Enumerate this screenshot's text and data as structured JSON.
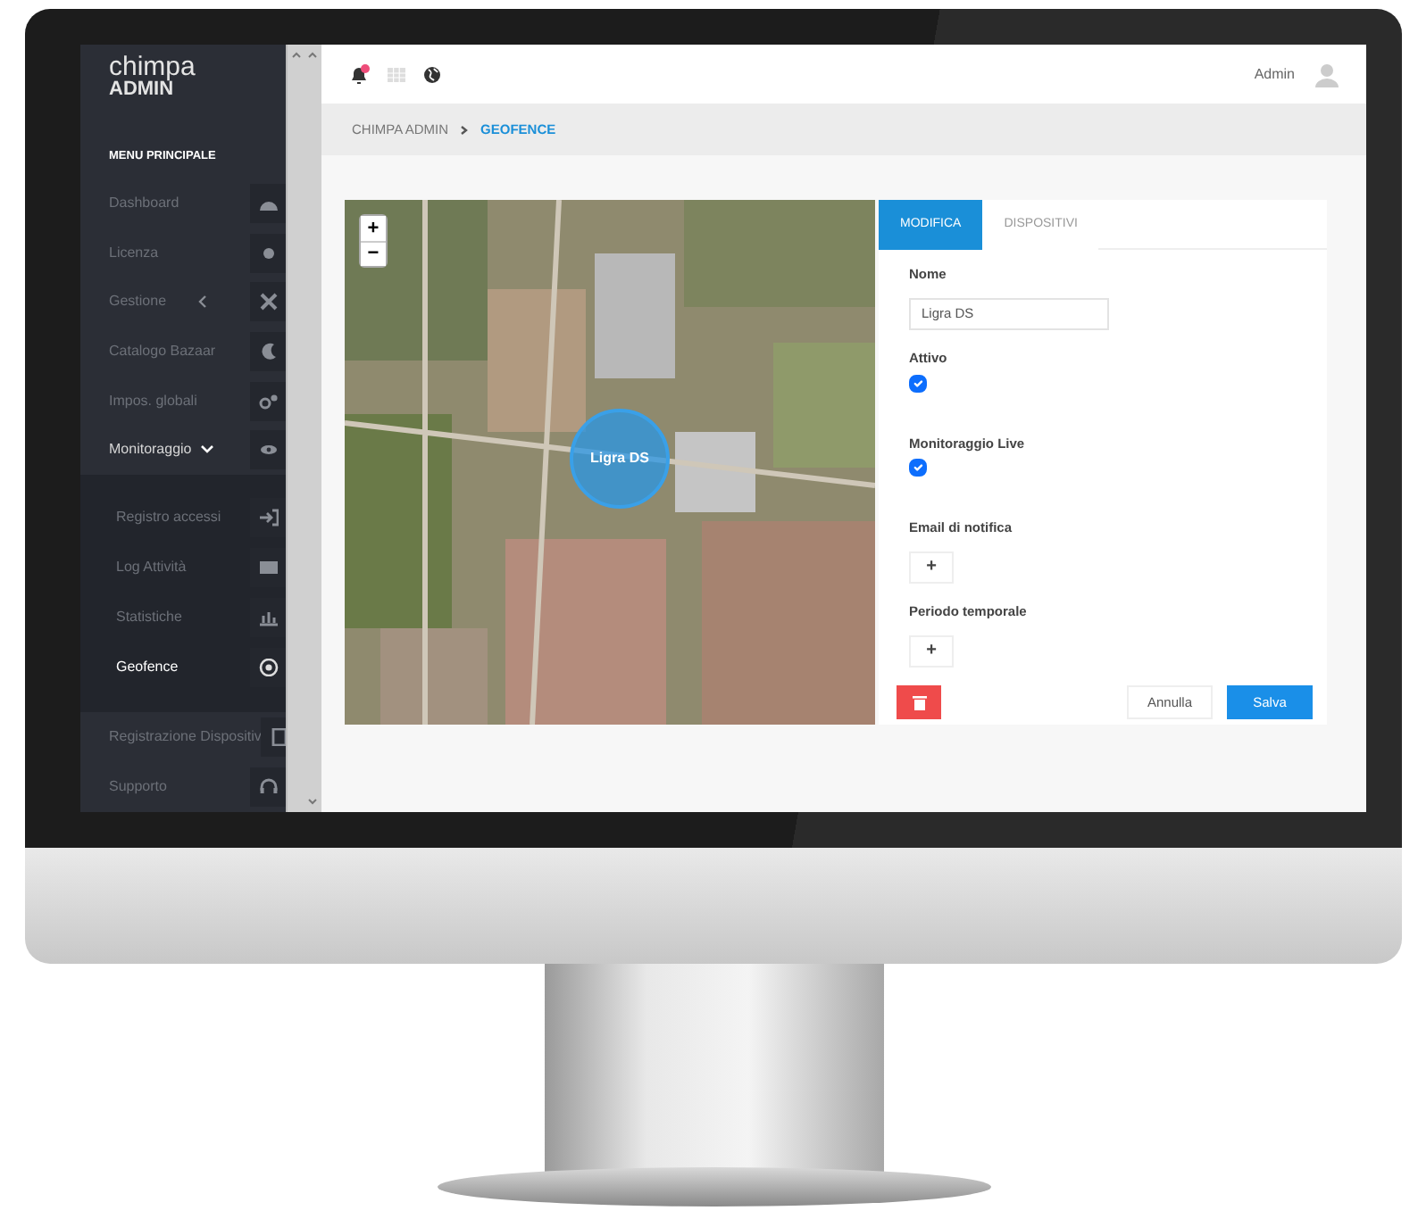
{
  "sidebar": {
    "logo": {
      "line_1": "chimpa",
      "line_2": "ADMIN"
    },
    "heading": "MENU PRINCIPALE",
    "items": [
      {
        "label": "Dashboard",
        "selected": false
      },
      {
        "label": "Licenza",
        "selected": false
      },
      {
        "label": "Gestione",
        "selected": false,
        "expanded": false
      },
      {
        "label": "Catalogo Bazaar",
        "selected": false
      },
      {
        "label": "Impos. globali",
        "selected": false
      },
      {
        "label": "Monitoraggio",
        "selected": false,
        "expanded": true,
        "children": [
          {
            "label": "Registro accessi",
            "selected": false
          },
          {
            "label": "Log Attività",
            "selected": false
          },
          {
            "label": "Statistiche",
            "selected": false
          },
          {
            "label": "Geofence",
            "selected": true
          }
        ]
      },
      {
        "label": "Registrazione Dispositiv",
        "selected": false
      },
      {
        "label": "Supporto",
        "selected": false
      }
    ]
  },
  "header": {
    "notification_dot": true,
    "user": "Admin"
  },
  "breadcrumb": [
    {
      "label": "CHIMPA ADMIN",
      "selected": false
    },
    {
      "label": "GEOFENCE",
      "selected": true
    }
  ],
  "map": {
    "zoom_in": "+",
    "zoom_out": "−",
    "marker": "Ligra DS"
  },
  "tabs": [
    {
      "label": "MODIFICA",
      "selected": true
    },
    {
      "label": "DISPOSITIVI",
      "selected": false
    }
  ],
  "fields": [
    {
      "kind": "text",
      "label": "Nome",
      "value": "Ligra DS"
    },
    {
      "kind": "checkbox",
      "label": "Attivo",
      "checked": true
    },
    {
      "kind": "checkbox",
      "label": "Monitoraggio Live",
      "checked": true
    },
    {
      "kind": "add",
      "label": "Email di notifica",
      "button": "+"
    },
    {
      "kind": "add",
      "label": "Periodo temporale",
      "button": "+"
    }
  ],
  "actions": {
    "cancel": "Annulla",
    "save": "Salva"
  }
}
